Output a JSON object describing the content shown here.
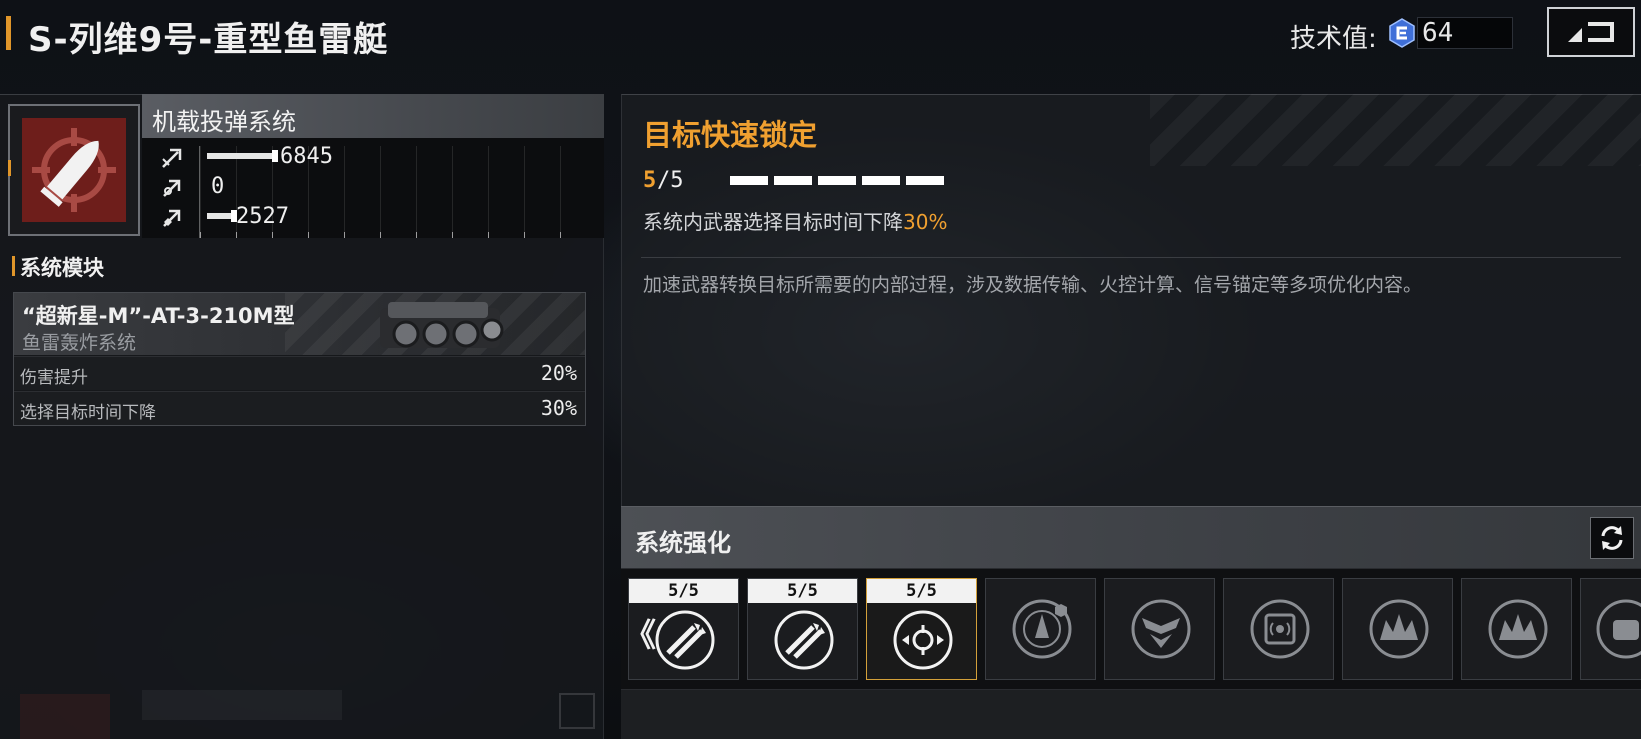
{
  "header": {
    "title": "S-列维9号-重型鱼雷艇",
    "tech_label": "技术值:",
    "tech_value": "64"
  },
  "system": {
    "name": "机载投弹系统",
    "icon": "bomb-shell-icon",
    "stats": [
      {
        "icon": "attack-stat-icon",
        "value": "6845",
        "fill": 0.18
      },
      {
        "icon": "speed-stat-icon",
        "value": "0",
        "fill": 0.0
      },
      {
        "icon": "defense-stat-icon",
        "value": "2527",
        "fill": 0.07
      }
    ]
  },
  "modules": {
    "title": "系统模块",
    "card": {
      "name": "“超新星-M”-AT-3-210M型",
      "type": "鱼雷轰炸系统",
      "rows": [
        {
          "label": "伤害提升",
          "value": "20%"
        },
        {
          "label": "选择目标时间下降",
          "value": "30%"
        }
      ]
    }
  },
  "detail": {
    "title": "目标快速锁定",
    "level_current": "5",
    "level_rest": "/5",
    "pips_filled": 5,
    "effect_prefix": "系统内武器选择目标时间下降",
    "effect_value": "30%",
    "description": "加速武器转换目标所需要的内部过程，涉及数据传输、火控计算、信号锚定等多项优化内容。"
  },
  "enhancement": {
    "title": "系统强化",
    "prev_label": "《",
    "nodes": [
      {
        "tag": "5/5",
        "icon": "missile-pair-icon",
        "state": "unlocked"
      },
      {
        "tag": "5/5",
        "icon": "missile-pair-icon",
        "state": "unlocked"
      },
      {
        "tag": "5/5",
        "icon": "target-lock-icon",
        "state": "active"
      },
      {
        "tag": "",
        "icon": "radar-ship-icon",
        "state": "locked"
      },
      {
        "tag": "",
        "icon": "shield-wings-icon",
        "state": "locked"
      },
      {
        "tag": "",
        "icon": "signal-chip-icon",
        "state": "locked"
      },
      {
        "tag": "",
        "icon": "explosion-crown-icon",
        "state": "locked"
      },
      {
        "tag": "",
        "icon": "explosion-crown-icon",
        "state": "locked"
      },
      {
        "tag": "",
        "icon": "fist-icon",
        "state": "locked"
      }
    ]
  },
  "colors": {
    "accent": "#f0a030",
    "system_icon_bg": "#6e1e1b",
    "active_border": "#d3a03a"
  }
}
